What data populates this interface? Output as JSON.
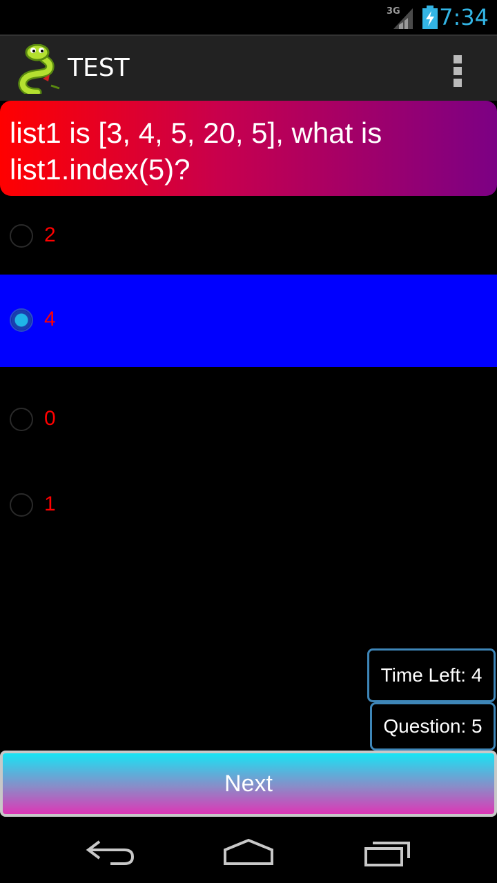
{
  "status": {
    "time": "7:34",
    "network": "3G"
  },
  "app": {
    "title": "TEST"
  },
  "question": {
    "text": "list1 is [3, 4, 5, 20, 5], what is list1.index(5)?"
  },
  "options": [
    {
      "label": "2",
      "selected": false
    },
    {
      "label": "4",
      "selected": true
    },
    {
      "label": "0",
      "selected": false
    },
    {
      "label": "1",
      "selected": false
    }
  ],
  "info": {
    "time_left": "Time Left: 4",
    "question_number": "Question: 5"
  },
  "buttons": {
    "next": "Next"
  },
  "icons": {
    "status": [
      "signal-3g-icon",
      "battery-charging-icon"
    ],
    "action_bar": [
      "snake-logo-icon",
      "overflow-menu-icon"
    ],
    "nav": [
      "back-icon",
      "home-icon",
      "recent-apps-icon"
    ]
  },
  "colors": {
    "clock": "#33b5e5",
    "selected_option_bg": "#0000ff",
    "option_text": "#ff0000",
    "info_border": "#3e86b8"
  }
}
